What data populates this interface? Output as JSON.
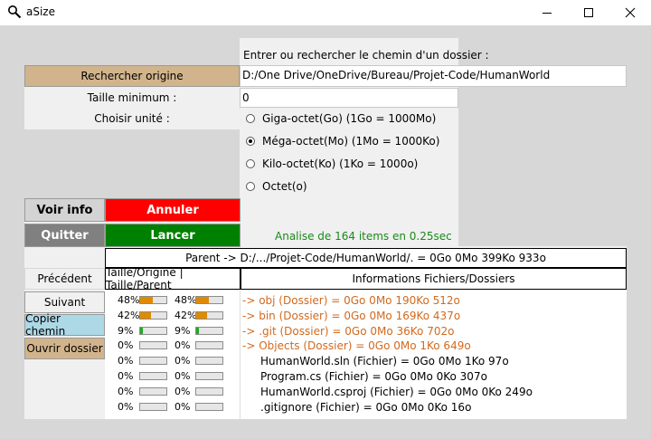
{
  "window": {
    "title": "aSize"
  },
  "path": {
    "prompt": "Entrer ou rechercher le chemin d'un dossier :",
    "value": "D:/One Drive/OneDrive/Bureau/Projet-Code/HumanWorld"
  },
  "buttons": {
    "search_origin": "Rechercher origine",
    "view_info": "Voir info",
    "cancel": "Annuler",
    "quit": "Quitter",
    "launch": "Lancer",
    "previous": "Précédent",
    "next": "Suivant",
    "copy_path": "Copier chemin",
    "open_folder": "Ouvrir dossier"
  },
  "min_size": {
    "label": "Taille minimum :",
    "value": "0"
  },
  "unit": {
    "label": "Choisir unité :",
    "options": [
      {
        "label": "Giga-octet(Go) (1Go = 1000Mo)",
        "selected": false
      },
      {
        "label": "Méga-octet(Mo) (1Mo = 1000Ko)",
        "selected": true
      },
      {
        "label": "Kilo-octet(Ko) (1Ko = 1000o)",
        "selected": false
      },
      {
        "label": "Octet(o)",
        "selected": false
      }
    ]
  },
  "status": {
    "text": "Analise de 164 items en 0.25sec",
    "color": "#1a8a1a"
  },
  "parent": {
    "text": "Parent -> D:/.../Projet-Code/HumanWorld/. = 0Go 0Mo 399Ko 933o"
  },
  "headers": {
    "sizes": "Taille/Origine | Taille/Parent",
    "info": "Informations Fichiers/Dossiers"
  },
  "colors": {
    "search_btn": "#d2b48c",
    "cancel_btn": "#ff0000",
    "launch_btn": "#008000",
    "view_info_btn": "#d3d3d3",
    "quit_btn": "#808080",
    "copy_btn": "#add8e6",
    "open_btn": "#d2b48c",
    "folder_text": "#d2691e",
    "bar_big": "#e08a00",
    "bar_small": "#22aa22"
  },
  "rows": [
    {
      "origin": "48%",
      "parent": "48%",
      "origin_pct": 48,
      "parent_pct": 48,
      "text": "-> obj (Dossier) = 0Go 0Mo 190Ko 512o",
      "folder": true
    },
    {
      "origin": "42%",
      "parent": "42%",
      "origin_pct": 42,
      "parent_pct": 42,
      "text": "-> bin (Dossier) = 0Go 0Mo 169Ko 437o",
      "folder": true
    },
    {
      "origin": "9%",
      "parent": "9%",
      "origin_pct": 9,
      "parent_pct": 9,
      "text": "-> .git (Dossier) = 0Go 0Mo 36Ko 702o",
      "folder": true
    },
    {
      "origin": "0%",
      "parent": "0%",
      "origin_pct": 0,
      "parent_pct": 0,
      "text": "-> Objects (Dossier) = 0Go 0Mo 1Ko 649o",
      "folder": true
    },
    {
      "origin": "0%",
      "parent": "0%",
      "origin_pct": 0,
      "parent_pct": 0,
      "text": "HumanWorld.sln (Fichier) = 0Go 0Mo 1Ko 97o",
      "folder": false
    },
    {
      "origin": "0%",
      "parent": "0%",
      "origin_pct": 0,
      "parent_pct": 0,
      "text": "Program.cs (Fichier) = 0Go 0Mo 0Ko 307o",
      "folder": false
    },
    {
      "origin": "0%",
      "parent": "0%",
      "origin_pct": 0,
      "parent_pct": 0,
      "text": "HumanWorld.csproj (Fichier) = 0Go 0Mo 0Ko 249o",
      "folder": false
    },
    {
      "origin": "0%",
      "parent": "0%",
      "origin_pct": 0,
      "parent_pct": 0,
      "text": ".gitignore (Fichier) = 0Go 0Mo 0Ko 16o",
      "folder": false
    }
  ]
}
